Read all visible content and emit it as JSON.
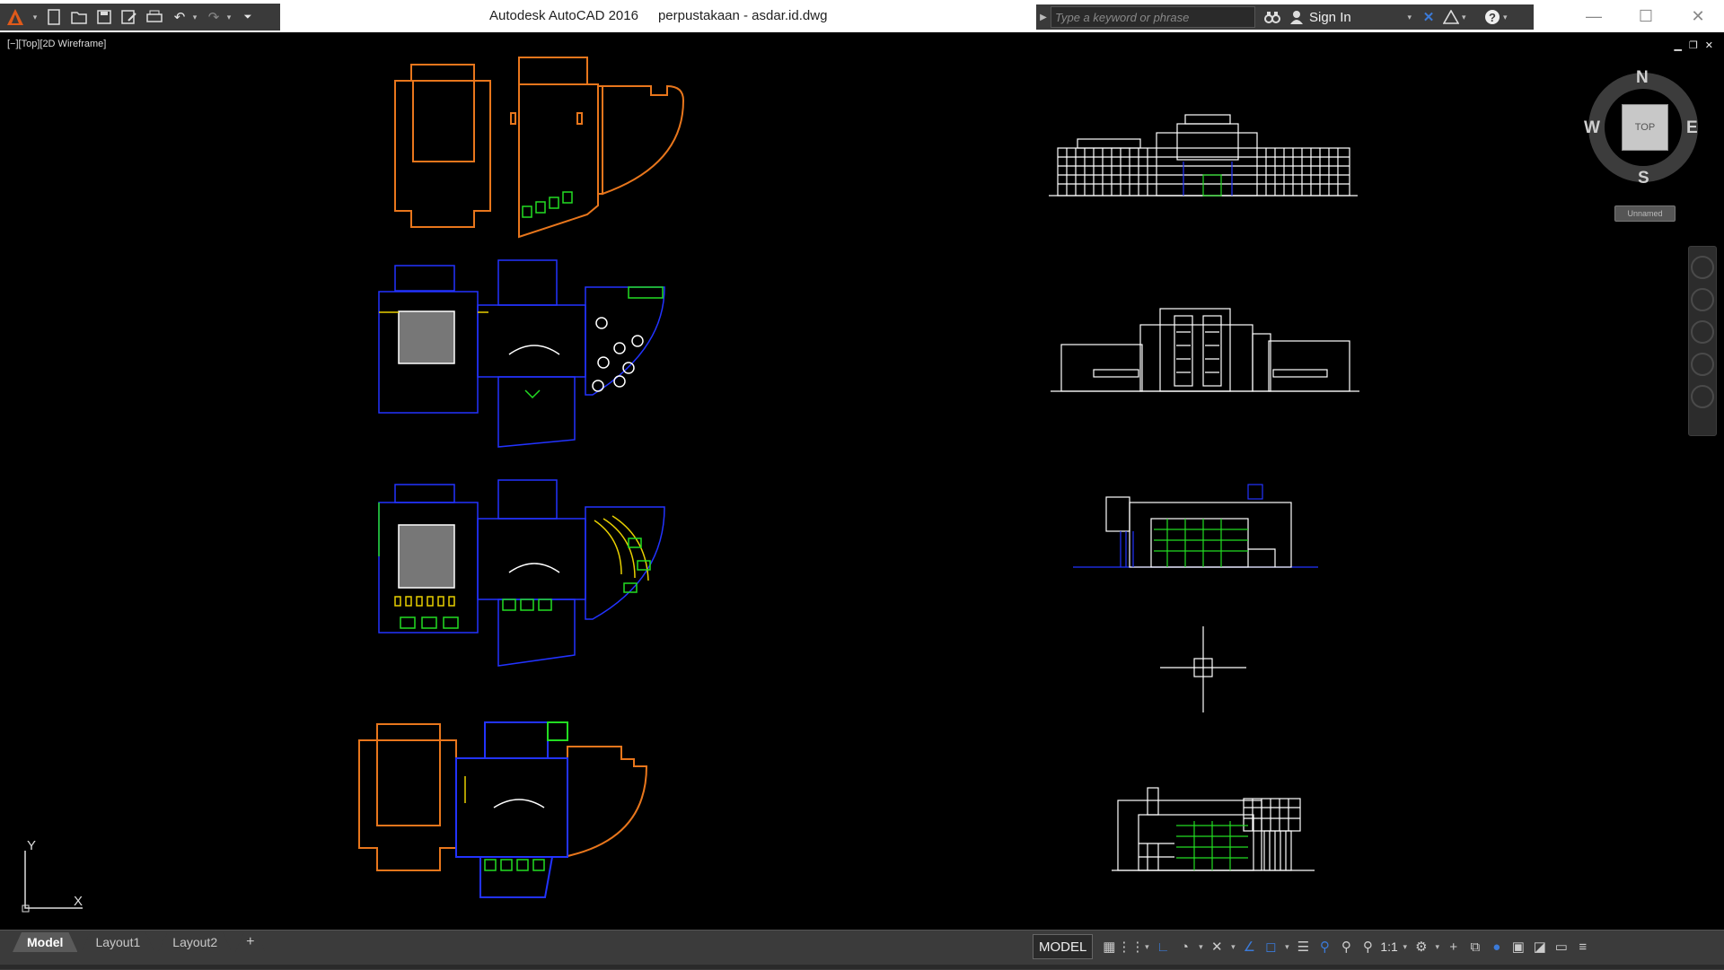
{
  "app": {
    "name": "Autodesk AutoCAD 2016",
    "document": "perpustakaan - asdar.id.dwg"
  },
  "quick_access": {
    "icons": [
      "autocad-logo-icon",
      "new-icon",
      "open-icon",
      "save-icon",
      "save-as-icon",
      "plot-icon",
      "undo-icon",
      "redo-icon",
      "workspace-dropdown-icon"
    ]
  },
  "search": {
    "placeholder": "Type a keyword or phrase"
  },
  "account": {
    "signin_label": "Sign In"
  },
  "viewport": {
    "label": "[−][Top][2D Wireframe]"
  },
  "viewcube": {
    "north": "N",
    "south": "S",
    "east": "E",
    "west": "W",
    "face": "TOP",
    "wcs": "Unnamed"
  },
  "ucs": {
    "x_label": "X",
    "y_label": "Y"
  },
  "layout_tabs": [
    {
      "label": "Model",
      "active": true
    },
    {
      "label": "Layout1",
      "active": false
    },
    {
      "label": "Layout2",
      "active": false
    },
    {
      "label": "+",
      "active": false
    }
  ],
  "statusbar": {
    "model_label": "MODEL",
    "scale_label": "1:1"
  },
  "colors": {
    "accent_orange": "#e8761c",
    "plan_blue": "#2233ff",
    "plan_green": "#22dd22",
    "plan_yellow": "#e8d000",
    "elevation_white": "#ffffff",
    "background": "#000000"
  }
}
